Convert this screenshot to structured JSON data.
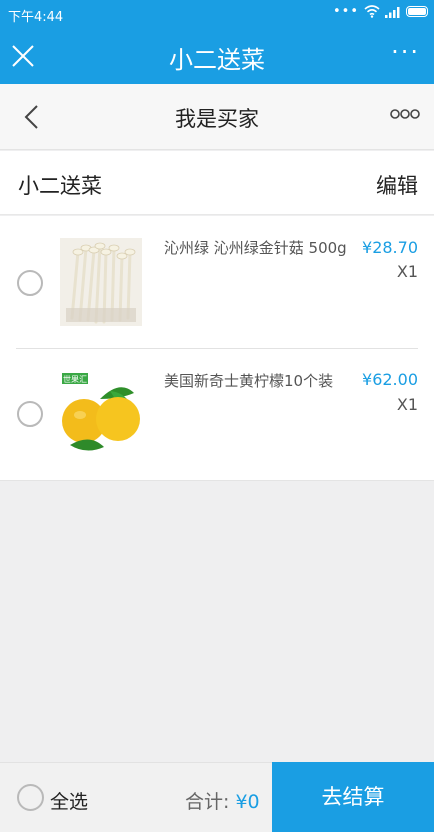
{
  "status_bar": {
    "time": "下午4:44",
    "signal_icon": "signal-icon",
    "wifi_icon": "wifi-icon",
    "battery_icon": "battery-icon"
  },
  "app_bar": {
    "title": "小二送菜",
    "close_icon": "close-icon",
    "more_label": "···"
  },
  "sub_bar": {
    "title": "我是买家",
    "back_icon": "chevron-left-icon",
    "more_icon": "more-circles-icon"
  },
  "shop": {
    "name": "小二送菜",
    "edit_label": "编辑"
  },
  "cart_items": [
    {
      "name": "沁州绿 沁州绿金针菇 500g",
      "price": "¥28.70",
      "qty": "X1",
      "image_icon": "enoki-mushroom-image"
    },
    {
      "name": "美国新奇士黄柠檬10个装",
      "price": "¥62.00",
      "qty": "X1",
      "image_icon": "lemon-image",
      "image_badge": "世果汇"
    }
  ],
  "footer": {
    "select_all_label": "全选",
    "total_label": "合计:",
    "total_amount": "¥0",
    "checkout_label": "去结算"
  },
  "colors": {
    "primary": "#1a9ee3",
    "background": "#efeff0"
  }
}
